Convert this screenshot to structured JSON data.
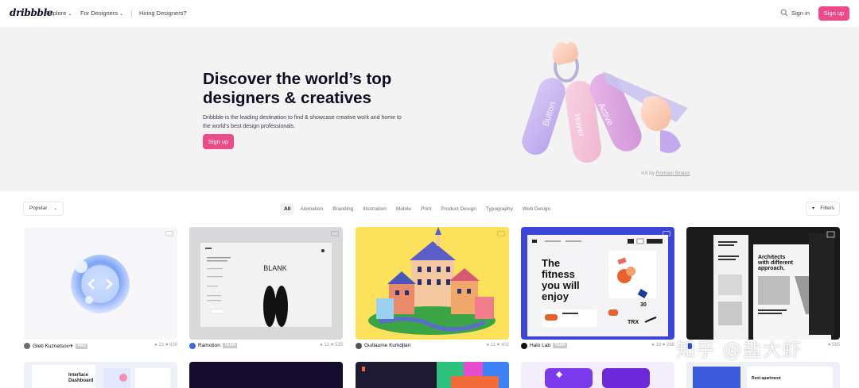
{
  "nav": {
    "logo": "dribbble",
    "explore": "Explore",
    "for_designers": "For Designers",
    "hiring": "Hiring Designers?",
    "signin": "Sign in",
    "signup": "Sign up",
    "chevron": "⌄"
  },
  "hero": {
    "title_line1": "Discover the world’s top",
    "title_line2": "designers & creatives",
    "desc_line1": "Dribbble is the leading destination to find & showcase creative work and home to",
    "desc_line2": "the world's best design professionals.",
    "signup": "Sign up",
    "art_by": "Art by",
    "art_author": "Romain Briaux",
    "tag_words": [
      "Button",
      "Hover",
      "Active"
    ]
  },
  "filters": {
    "sort": "Popular",
    "categories": [
      "All",
      "Animation",
      "Branding",
      "Illustration",
      "Mobile",
      "Print",
      "Product Design",
      "Typography",
      "Web Design"
    ],
    "active_category": "All",
    "filters_label": "Filters"
  },
  "shots": [
    {
      "author": "Gleb Kuznetsov✈",
      "badge": "PRO",
      "comments": "21",
      "likes": "639"
    },
    {
      "author": "Ramotion",
      "badge": "TEAM",
      "comments": "12",
      "likes": "535",
      "art_text": "BLANK"
    },
    {
      "author": "Guillaume Kurkdjian",
      "badge": "",
      "comments": "11",
      "likes": "402"
    },
    {
      "author": "Halo Lab",
      "badge": "TEAM",
      "comments": "18",
      "likes": "288",
      "art_text": [
        "The",
        "fitness",
        "you will",
        "enjoy"
      ],
      "art_num": "30",
      "art_brand": "TRX"
    },
    {
      "author": "",
      "badge": "",
      "comments": "",
      "likes": "565",
      "art_text": [
        "Architects",
        "with different",
        "approach."
      ]
    }
  ],
  "shots_row2": [
    {
      "art_text": [
        "Interface",
        "Dashboard"
      ]
    },
    {},
    {},
    {},
    {
      "art_text": [
        "Rent apartment"
      ]
    }
  ],
  "watermark": "知乎 @盐大虾",
  "colors": {
    "accent": "#ea4c89",
    "text": "#0d0c22",
    "muted": "#9e9ea7",
    "hero_bg": "#f3f3f4"
  }
}
